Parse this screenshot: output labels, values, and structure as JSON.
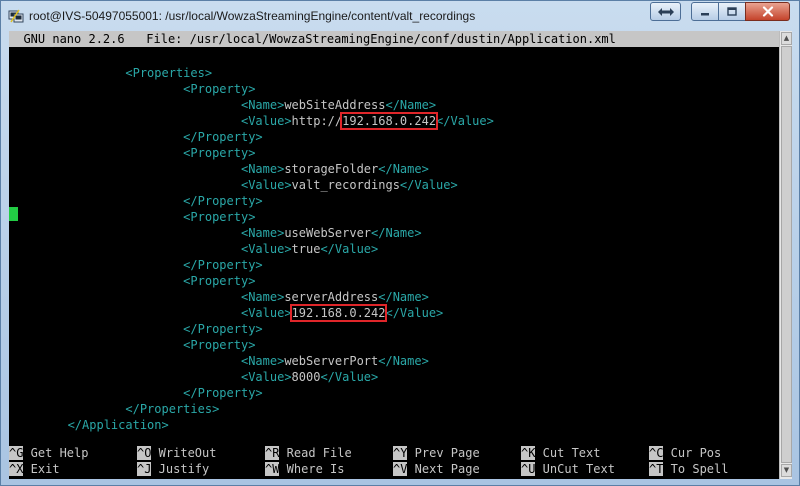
{
  "window": {
    "title": "root@IVS-50497055001: /usr/local/WowzaStreamingEngine/content/valt_recordings"
  },
  "nano": {
    "header": "  GNU nano 2.2.6   File: /usr/local/WowzaStreamingEngine/conf/dustin/Application.xml"
  },
  "lines": [
    {
      "indent": "               ",
      "parts": [
        {
          "t": "<Properties>",
          "c": "tag"
        }
      ]
    },
    {
      "indent": "                       ",
      "parts": [
        {
          "t": "<Property>",
          "c": "tag"
        }
      ]
    },
    {
      "indent": "                               ",
      "parts": [
        {
          "t": "<Name>",
          "c": "tag"
        },
        {
          "t": "webSiteAddress",
          "c": "txt"
        },
        {
          "t": "</Name>",
          "c": "tag"
        }
      ]
    },
    {
      "indent": "                               ",
      "parts": [
        {
          "t": "<Value>",
          "c": "tag"
        },
        {
          "t": "http://",
          "c": "txt"
        },
        {
          "t": "192.168.0.242",
          "c": "hl"
        },
        {
          "t": "</Value>",
          "c": "tag"
        }
      ]
    },
    {
      "indent": "                       ",
      "parts": [
        {
          "t": "</Property>",
          "c": "tag"
        }
      ]
    },
    {
      "indent": "                       ",
      "parts": [
        {
          "t": "<Property>",
          "c": "tag"
        }
      ]
    },
    {
      "indent": "                               ",
      "parts": [
        {
          "t": "<Name>",
          "c": "tag"
        },
        {
          "t": "storageFolder",
          "c": "txt"
        },
        {
          "t": "</Name>",
          "c": "tag"
        }
      ]
    },
    {
      "indent": "                               ",
      "parts": [
        {
          "t": "<Value>",
          "c": "tag"
        },
        {
          "t": "valt_recordings",
          "c": "txt"
        },
        {
          "t": "</Value>",
          "c": "tag"
        }
      ]
    },
    {
      "indent": "                       ",
      "parts": [
        {
          "t": "</Property>",
          "c": "tag"
        }
      ]
    },
    {
      "indent": "                       ",
      "parts": [
        {
          "t": "<Property>",
          "c": "tag"
        }
      ]
    },
    {
      "indent": "                               ",
      "parts": [
        {
          "t": "<Name>",
          "c": "tag"
        },
        {
          "t": "useWebServer",
          "c": "txt"
        },
        {
          "t": "</Name>",
          "c": "tag"
        }
      ]
    },
    {
      "indent": "                               ",
      "parts": [
        {
          "t": "<Value>",
          "c": "tag"
        },
        {
          "t": "true",
          "c": "txt"
        },
        {
          "t": "</Value>",
          "c": "tag"
        }
      ]
    },
    {
      "indent": "                       ",
      "parts": [
        {
          "t": "</Property>",
          "c": "tag"
        }
      ]
    },
    {
      "indent": "                       ",
      "parts": [
        {
          "t": "<Property>",
          "c": "tag"
        }
      ]
    },
    {
      "indent": "                               ",
      "parts": [
        {
          "t": "<Name>",
          "c": "tag"
        },
        {
          "t": "serverAddress",
          "c": "txt"
        },
        {
          "t": "</Name>",
          "c": "tag"
        }
      ]
    },
    {
      "indent": "                               ",
      "parts": [
        {
          "t": "<Value>",
          "c": "tag"
        },
        {
          "t": "192.168.0.242",
          "c": "hl"
        },
        {
          "t": "</Value>",
          "c": "tag"
        }
      ]
    },
    {
      "indent": "                       ",
      "parts": [
        {
          "t": "</Property>",
          "c": "tag"
        }
      ]
    },
    {
      "indent": "                       ",
      "parts": [
        {
          "t": "<Property>",
          "c": "tag"
        }
      ]
    },
    {
      "indent": "                               ",
      "parts": [
        {
          "t": "<Name>",
          "c": "tag"
        },
        {
          "t": "webServerPort",
          "c": "txt"
        },
        {
          "t": "</Name>",
          "c": "tag"
        }
      ]
    },
    {
      "indent": "                               ",
      "parts": [
        {
          "t": "<Value>",
          "c": "tag"
        },
        {
          "t": "8000",
          "c": "txt"
        },
        {
          "t": "</Value>",
          "c": "tag"
        }
      ]
    },
    {
      "indent": "                       ",
      "parts": [
        {
          "t": "</Property>",
          "c": "tag"
        }
      ]
    },
    {
      "indent": "               ",
      "parts": [
        {
          "t": "</Properties>",
          "c": "tag"
        }
      ]
    },
    {
      "indent": "       ",
      "parts": [
        {
          "t": "</Application>",
          "c": "tag"
        }
      ]
    }
  ],
  "help": {
    "row1": [
      {
        "key": "^G",
        "label": "Get Help"
      },
      {
        "key": "^O",
        "label": "WriteOut"
      },
      {
        "key": "^R",
        "label": "Read File"
      },
      {
        "key": "^Y",
        "label": "Prev Page"
      },
      {
        "key": "^K",
        "label": "Cut Text"
      },
      {
        "key": "^C",
        "label": "Cur Pos"
      }
    ],
    "row2": [
      {
        "key": "^X",
        "label": "Exit"
      },
      {
        "key": "^J",
        "label": "Justify"
      },
      {
        "key": "^W",
        "label": "Where Is"
      },
      {
        "key": "^V",
        "label": "Next Page"
      },
      {
        "key": "^U",
        "label": "UnCut Text"
      },
      {
        "key": "^T",
        "label": "To Spell"
      }
    ]
  },
  "icons": {
    "app": "putty-icon",
    "resize": "resize-arrows-icon",
    "minimize": "minimize-icon",
    "maximize": "maximize-icon",
    "close": "close-icon"
  },
  "colors": {
    "terminal_bg": "#000000",
    "xml_tag": "#2aa8a8",
    "text": "#c6c6c6",
    "highlight_box": "#e0262a",
    "cursor": "#22cc44"
  }
}
